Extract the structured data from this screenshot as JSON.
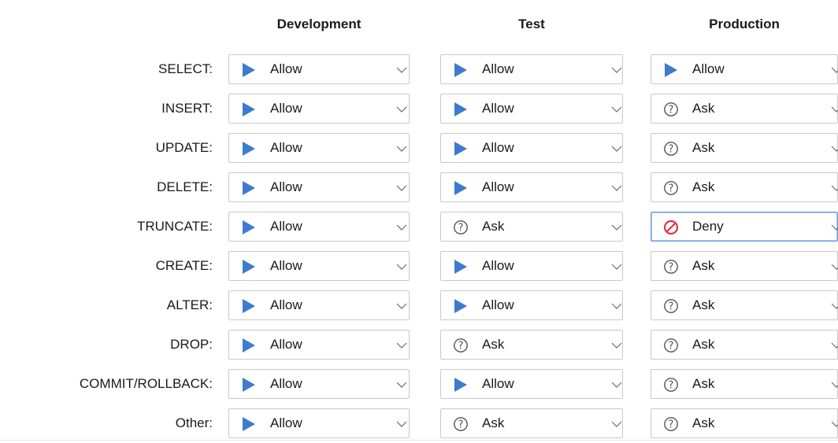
{
  "columns": [
    "Development",
    "Test",
    "Production"
  ],
  "rows": [
    {
      "label": "SELECT:",
      "values": [
        "Allow",
        "Allow",
        "Allow"
      ]
    },
    {
      "label": "INSERT:",
      "values": [
        "Allow",
        "Allow",
        "Ask"
      ]
    },
    {
      "label": "UPDATE:",
      "values": [
        "Allow",
        "Allow",
        "Ask"
      ]
    },
    {
      "label": "DELETE:",
      "values": [
        "Allow",
        "Allow",
        "Ask"
      ]
    },
    {
      "label": "TRUNCATE:",
      "values": [
        "Allow",
        "Ask",
        "Deny"
      ]
    },
    {
      "label": "CREATE:",
      "values": [
        "Allow",
        "Allow",
        "Ask"
      ]
    },
    {
      "label": "ALTER:",
      "values": [
        "Allow",
        "Allow",
        "Ask"
      ]
    },
    {
      "label": "DROP:",
      "values": [
        "Allow",
        "Ask",
        "Ask"
      ]
    },
    {
      "label": "COMMIT/ROLLBACK:",
      "values": [
        "Allow",
        "Allow",
        "Ask"
      ]
    },
    {
      "label": "Other:",
      "values": [
        "Allow",
        "Ask",
        "Ask"
      ]
    }
  ],
  "focused_cell": {
    "row": 4,
    "column": 2
  },
  "icons": {
    "Allow": "play-triangle-icon",
    "Ask": "question-circle-icon",
    "Deny": "deny-circle-icon"
  },
  "colors": {
    "allow": "#3d7bd0",
    "ask": "#555555",
    "deny": "#e0334a",
    "focus_border": "#6a9cdc"
  }
}
